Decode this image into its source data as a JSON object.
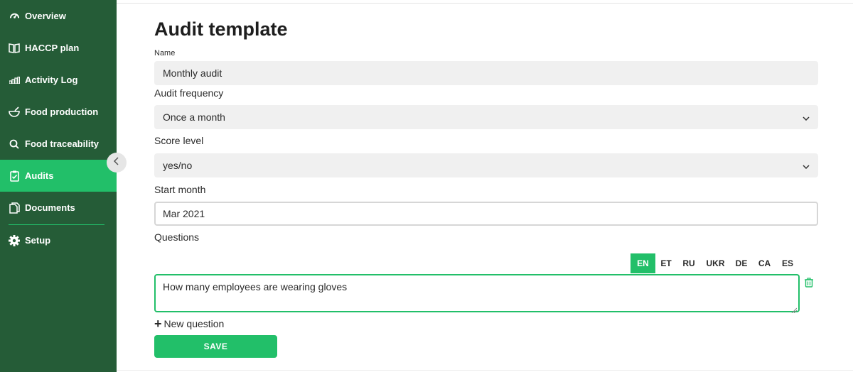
{
  "sidebar": {
    "items": [
      {
        "label": "Overview",
        "icon": "speedometer-icon"
      },
      {
        "label": "HACCP plan",
        "icon": "book-icon"
      },
      {
        "label": "Activity Log",
        "icon": "bar-chart-icon"
      },
      {
        "label": "Food production",
        "icon": "bowl-icon"
      },
      {
        "label": "Food traceability",
        "icon": "search-icon"
      },
      {
        "label": "Audits",
        "icon": "clipboard-check-icon",
        "active": true
      },
      {
        "label": "Documents",
        "icon": "documents-icon"
      },
      {
        "label": "Setup",
        "icon": "gear-icon"
      }
    ],
    "collapse_icon": "chevron-left-icon"
  },
  "page": {
    "title": "Audit template"
  },
  "form": {
    "name_label": "Name",
    "name_value": "Monthly audit",
    "frequency_label": "Audit frequency",
    "frequency_value": "Once a month",
    "score_label": "Score level",
    "score_value": "yes/no",
    "start_month_label": "Start month",
    "start_month_value": "Mar 2021",
    "questions_label": "Questions",
    "languages": [
      "EN",
      "ET",
      "RU",
      "UKR",
      "DE",
      "CA",
      "ES"
    ],
    "active_language": "EN",
    "question_value": "How many employees are wearing gloves",
    "new_question_label": "New question",
    "save_label": "SAVE"
  },
  "colors": {
    "sidebar_bg": "#255c37",
    "accent": "#22bf69",
    "field_bg": "#f0f0f0"
  }
}
